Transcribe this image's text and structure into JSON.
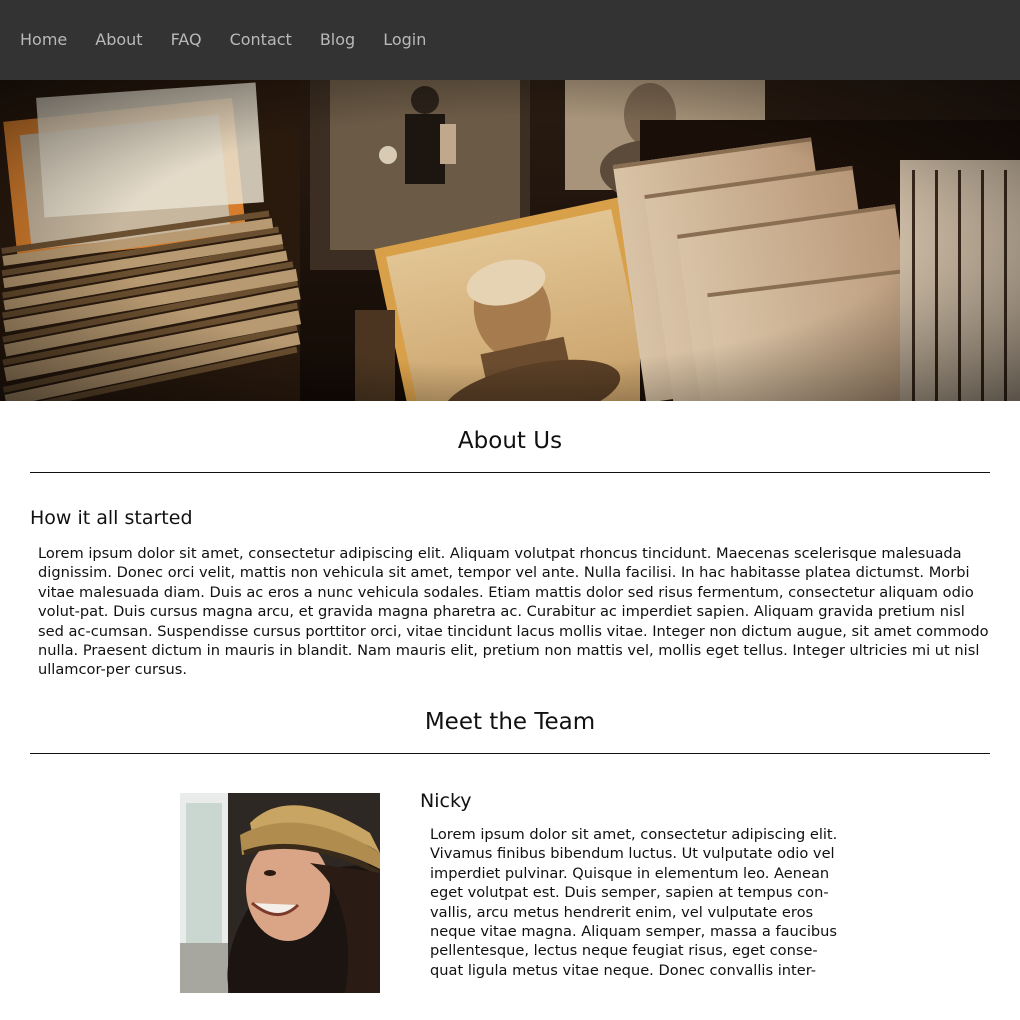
{
  "nav": {
    "items": [
      "Home",
      "About",
      "FAQ",
      "Contact",
      "Blog",
      "Login"
    ]
  },
  "hero": {
    "image": "vintage-photographs-photo"
  },
  "about": {
    "title": "About Us",
    "subtitle": "How it all started",
    "body": "Lorem ipsum dolor sit amet, consectetur adipiscing elit. Aliquam volutpat rhoncus tincidunt. Maecenas scelerisque malesuada dignissim. Donec orci velit, mattis non vehicula sit amet, tempor vel ante. Nulla facilisi. In hac habitasse platea dictumst. Morbi vitae malesuada diam. Duis ac eros a nunc vehicula sodales. Etiam mattis dolor sed risus fermentum, consectetur aliquam odio volut-pat. Duis cursus magna arcu, et gravida magna pharetra ac. Curabitur ac imperdiet sapien. Aliquam gravida pretium nisl sed ac-cumsan. Suspendisse cursus porttitor orci, vitae tincidunt lacus mollis vitae. Integer non dictum augue, sit amet commodo nulla. Praesent dictum in mauris in blandit. Nam mauris elit, pretium non mattis vel, mollis eget tellus. Integer ultricies mi ut nisl ullamcor-per cursus."
  },
  "team": {
    "title": "Meet the Team",
    "members": [
      {
        "name": "Nicky",
        "photo": "woman-in-hat-photo",
        "bio": "Lorem ipsum dolor sit amet, consectetur adipiscing elit. Vivamus finibus bibendum luctus. Ut vulputate odio vel imperdiet pulvinar. Quisque in elementum leo. Aenean eget volutpat est. Duis semper, sapien at tempus con-vallis, arcu metus hendrerit enim, vel vulputate eros neque vitae magna. Aliquam semper, massa a faucibus pellentesque, lectus neque feugiat risus, eget conse-quat ligula metus vitae neque. Donec convallis inter-"
      }
    ]
  }
}
